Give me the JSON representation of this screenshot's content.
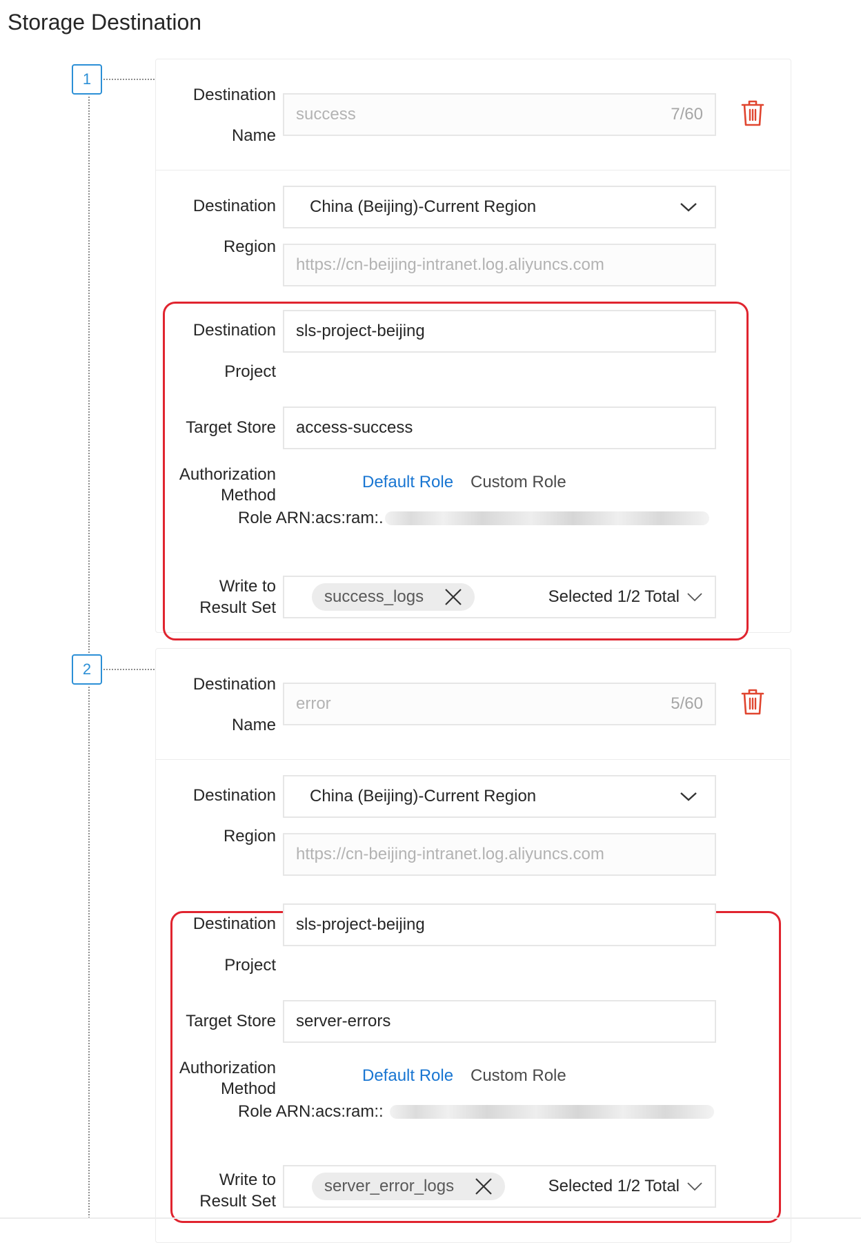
{
  "page": {
    "title": "Storage Destination"
  },
  "destinations": [
    {
      "index": "1",
      "name_label_1": "Destination",
      "name_label_2": "Name",
      "name_value": "success",
      "name_counter": "7/60",
      "region_label_1": "Destination",
      "region_label_2": "Region",
      "region_value": "China (Beijing)-Current Region",
      "endpoint": "https://cn-beijing-intranet.log.aliyuncs.com",
      "project_label_1": "Destination",
      "project_label_2": "Project",
      "project_value": "sls-project-beijing",
      "store_label": "Target Store",
      "store_value": "access-success",
      "auth_label_1": "Authorization",
      "auth_label_2": "Method",
      "auth_default": "Default Role",
      "auth_custom": "Custom Role",
      "role_arn": "Role ARN:acs:ram:.",
      "write_label_1": "Write to",
      "write_label_2": "Result Set",
      "result_tag": "success_logs",
      "result_summary": "Selected 1/2 Total"
    },
    {
      "index": "2",
      "name_label_1": "Destination",
      "name_label_2": "Name",
      "name_value": "error",
      "name_counter": "5/60",
      "region_label_1": "Destination",
      "region_label_2": "Region",
      "region_value": "China (Beijing)-Current Region",
      "endpoint": "https://cn-beijing-intranet.log.aliyuncs.com",
      "project_label_1": "Destination",
      "project_label_2": "Project",
      "project_value": "sls-project-beijing",
      "store_label": "Target Store",
      "store_value": "server-errors",
      "auth_label_1": "Authorization",
      "auth_label_2": "Method",
      "auth_default": "Default Role",
      "auth_custom": "Custom Role",
      "role_arn": "Role ARN:acs:ram::",
      "write_label_1": "Write to",
      "write_label_2": "Result Set",
      "result_tag": "server_error_logs",
      "result_summary": "Selected 1/2 Total"
    }
  ],
  "colors": {
    "accent": "#1976d2",
    "step_border": "#2b8fd6",
    "highlight": "#e0242f",
    "trash": "#e0452f"
  }
}
